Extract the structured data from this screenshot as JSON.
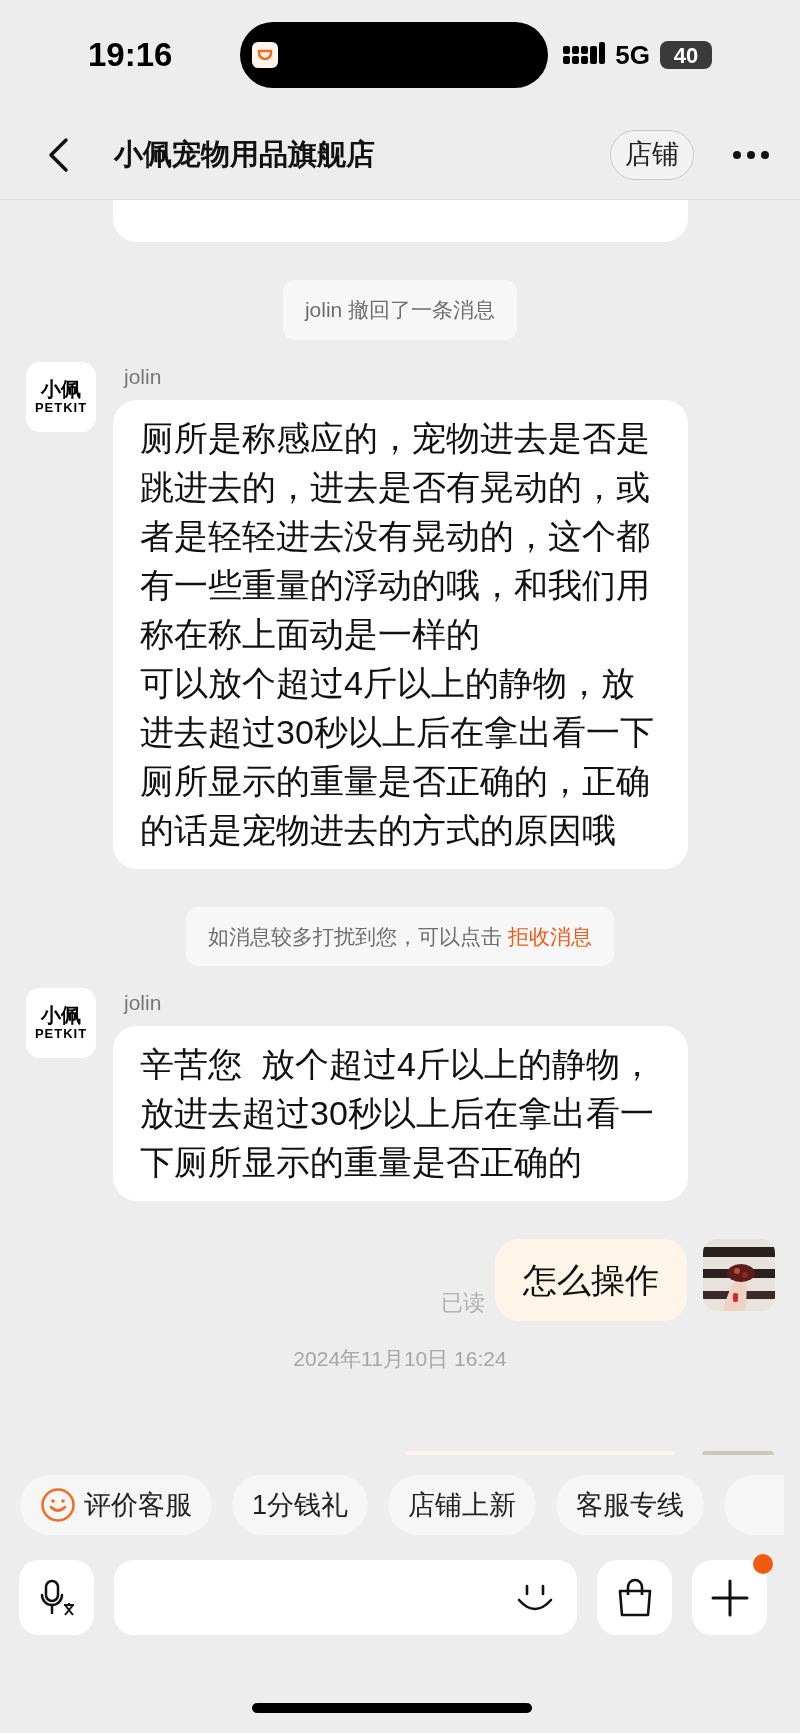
{
  "status_bar": {
    "time": "19:16",
    "network": "5G",
    "battery": "40"
  },
  "header": {
    "title": "小佩宠物用品旗舰店",
    "shop_button": "店铺"
  },
  "messages": [
    {
      "kind": "cut_bubble"
    },
    {
      "kind": "notice",
      "text": "jolin 撤回了一条消息"
    },
    {
      "kind": "incoming",
      "sender": "jolin",
      "avatar_lines": [
        "小佩",
        "PETKIT"
      ],
      "paragraphs": [
        "厕所是称感应的，宠物进去是否是跳进去的，进去是否有晃动的，或者是轻轻进去没有晃动的，这个都有一些重量的浮动的哦，和我们用称在称上面动是一样的",
        "可以放个超过4斤以上的静物，放进去超过30秒以上后在拿出看一下厕所显示的重量是否正确的，正确的话是宠物进去的方式的原因哦"
      ]
    },
    {
      "kind": "notice",
      "text": "如消息较多打扰到您，可以点击",
      "link": "拒收消息"
    },
    {
      "kind": "incoming",
      "sender": "jolin",
      "avatar_lines": [
        "小佩",
        "PETKIT"
      ],
      "paragraphs": [
        "辛苦您  放个超过4斤以上的静物，放进去超过30秒以上后在拿出看一下厕所显示的重量是否正确的"
      ]
    },
    {
      "kind": "outgoing",
      "text": "怎么操作",
      "read_label": "已读"
    },
    {
      "kind": "timestamp",
      "text": "2024年11月10日 16:24"
    }
  ],
  "quick_replies": [
    {
      "label": "评价客服",
      "icon": true
    },
    {
      "label": "1分钱礼",
      "icon": false
    },
    {
      "label": "店铺上新",
      "icon": false
    },
    {
      "label": "客服专线",
      "icon": false
    }
  ],
  "composer": {
    "plus_badge": true
  }
}
